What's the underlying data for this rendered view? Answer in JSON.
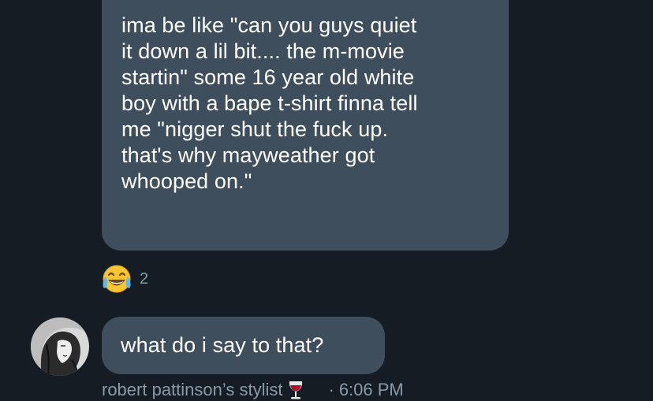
{
  "messages": [
    {
      "lines": [
        "ima be like \"can you guys quiet",
        "it down a lil bit.... the m-movie",
        "startin\" some 16 year old white",
        "boy with a bape t-shirt finna tell",
        "me \"nigger shut the fuck up.",
        "that's why mayweather got",
        "whooped on.\""
      ],
      "reaction": {
        "icon": "joy-emoji-icon",
        "count": "2"
      }
    },
    {
      "text": "what do i say to that?"
    }
  ],
  "meta": {
    "sender": "robert pattinson’s stylist",
    "sender_emoji": "wine-glass-icon",
    "separator": "·",
    "time": "6:06 PM"
  },
  "colors": {
    "background": "#151c24",
    "bubble": "#3f4e5c",
    "text": "#ffffff",
    "muted": "#8a9aa8"
  }
}
